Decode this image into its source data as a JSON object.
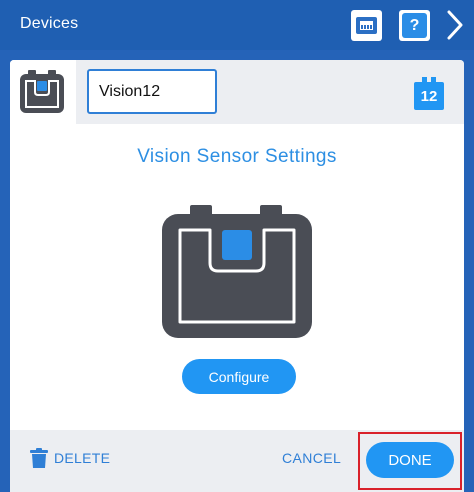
{
  "header": {
    "title": "Devices",
    "help_glyph": "?",
    "icons": [
      "port-icon",
      "help-icon",
      "chevron-right-icon"
    ]
  },
  "device": {
    "name_value": "Vision12",
    "port_number": "12",
    "icon": "vision-sensor-icon"
  },
  "main": {
    "title": "Vision Sensor Settings",
    "configure_label": "Configure"
  },
  "footer": {
    "delete_label": "DELETE",
    "cancel_label": "CANCEL",
    "done_label": "DONE",
    "delete_icon": "trash-icon"
  },
  "colors": {
    "header_bg": "#1f5fb2",
    "accent": "#2196f3",
    "title_blue": "#2d8fe3",
    "sensor_body": "#4a4d55",
    "sensor_lens": "#2b8de6",
    "highlight_red": "#d9202a",
    "panel_gray": "#eceef2"
  }
}
